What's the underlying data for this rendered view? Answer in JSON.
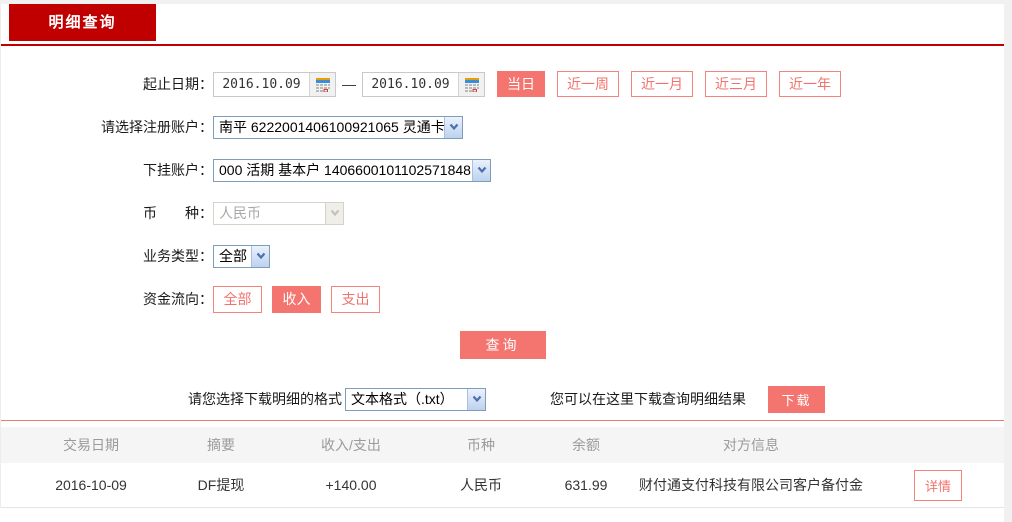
{
  "tab": {
    "label": "明细查询"
  },
  "form": {
    "date_range": {
      "label": "起止日期：",
      "start": "2016.10.09",
      "end": "2016.10.09",
      "separator": "—",
      "quick_buttons": [
        {
          "label": "当日",
          "active": true
        },
        {
          "label": "近一周",
          "active": false
        },
        {
          "label": "近一月",
          "active": false
        },
        {
          "label": "近三月",
          "active": false
        },
        {
          "label": "近一年",
          "active": false
        }
      ]
    },
    "register_account": {
      "label": "请选择注册账户：",
      "value": "南平 6222001406100921065 灵通卡"
    },
    "sub_account": {
      "label": "下挂账户：",
      "value": "000 活期 基本户 1406600101102571848"
    },
    "currency": {
      "label": "币　　种：",
      "value": "人民币",
      "disabled": true
    },
    "business_type": {
      "label": "业务类型：",
      "value": "全部"
    },
    "fund_flow": {
      "label": "资金流向：",
      "buttons": [
        {
          "label": "全部",
          "active": false
        },
        {
          "label": "收入",
          "active": true
        },
        {
          "label": "支出",
          "active": false
        }
      ]
    },
    "query_button": "查询"
  },
  "download": {
    "format_label": "请您选择下载明细的格式",
    "format_value": "文本格式（.txt）",
    "hint": "您可以在这里下载查询明细结果",
    "button": "下载"
  },
  "table": {
    "headers": [
      "交易日期",
      "摘要",
      "收入/支出",
      "币种",
      "余额",
      "对方信息",
      ""
    ],
    "rows": [
      {
        "date": "2016-10-09",
        "summary": "DF提现",
        "amount": "+140.00",
        "currency": "人民币",
        "balance": "631.99",
        "counterparty": "财付通支付科技有限公司客户备付金",
        "action": "详情"
      }
    ]
  },
  "colors": {
    "accent_red": "#c00000",
    "salmon": "#f4756f",
    "amount_red": "#e00000"
  }
}
